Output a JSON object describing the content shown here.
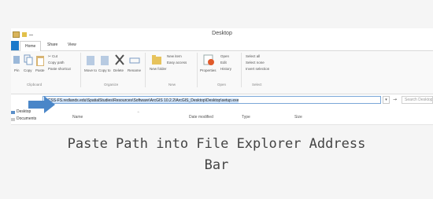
{
  "window": {
    "title": "Desktop"
  },
  "tabs": [
    {
      "label": "Home"
    },
    {
      "label": "Share"
    },
    {
      "label": "View"
    }
  ],
  "ribbon": {
    "clipboard": {
      "cut": "Cut",
      "copy_path": "Copy path",
      "paste_shortcut": "Paste shortcut",
      "paste": "Paste",
      "group": "Clipboard"
    },
    "organize": {
      "move_to": "Move to",
      "copy_to": "Copy to",
      "delete": "Delete",
      "rename": "Rename",
      "group": "Organize"
    },
    "new": {
      "new_item": "New item",
      "easy_access": "Easy access",
      "new_folder": "New folder",
      "group": "New"
    },
    "open": {
      "properties": "Properties",
      "open": "Open",
      "edit": "Edit",
      "history": "History",
      "group": "Open"
    },
    "select": {
      "select_all": "Select all",
      "select_none": "Select none",
      "invert_selection": "Invert selection",
      "group": "Select"
    }
  },
  "address_bar": {
    "path": "\\\\CSS-FS.redlands.edu\\SpatialStudies\\Resources\\Software\\ArcGIS 10.2.2\\ArcGIS_Desktop\\Desktop\\setup.exe",
    "search_placeholder": "Search Desktop"
  },
  "nav_pane": {
    "items": [
      {
        "label": "Desktop"
      },
      {
        "label": "Documents"
      }
    ]
  },
  "columns": {
    "name": "Name",
    "date_modified": "Date modified",
    "type": "Type",
    "size": "Size"
  },
  "caption": {
    "line1": "Paste Path into File Explorer Address",
    "line2": "Bar"
  },
  "colors": {
    "accent": "#1979ca",
    "arrow": "#4a86c8",
    "address_border": "#7aa7d8"
  }
}
